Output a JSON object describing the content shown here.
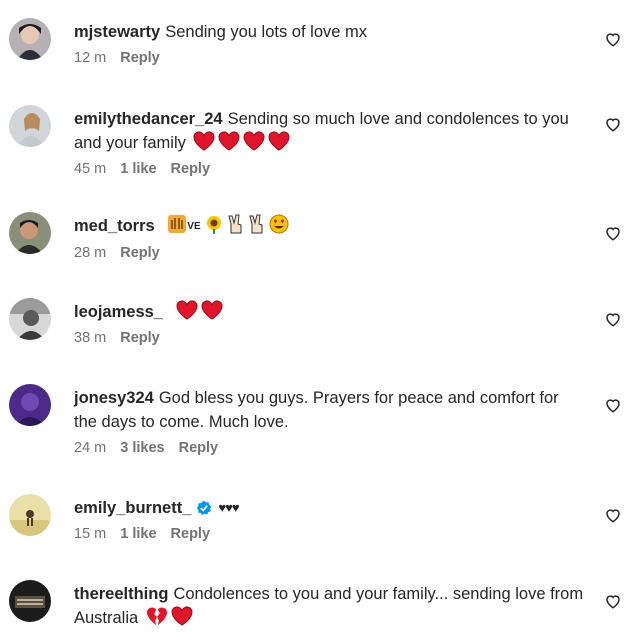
{
  "comments": [
    {
      "username": "mjstewarty",
      "text": "Sending you lots of love mx",
      "time": "12 m",
      "likes": "",
      "reply": "Reply"
    },
    {
      "username": "emilythedancer_24",
      "text": "Sending so much love and condolences to you and your family",
      "time": "45 m",
      "likes": "1 like",
      "reply": "Reply"
    },
    {
      "username": "med_torrs",
      "text": "",
      "time": "28 m",
      "likes": "",
      "reply": "Reply",
      "emoji_text": "VE"
    },
    {
      "username": "leojamess_",
      "text": "",
      "time": "38 m",
      "likes": "",
      "reply": "Reply"
    },
    {
      "username": "jonesy324",
      "text": "God bless you guys. Prayers for peace and comfort for the days to come. Much love.",
      "time": "24 m",
      "likes": "3 likes",
      "reply": "Reply"
    },
    {
      "username": "emily_burnett_",
      "text": "",
      "time": "15 m",
      "likes": "1 like",
      "reply": "Reply",
      "hearts": "♥♥♥"
    },
    {
      "username": "thereelthing",
      "text": "Condolences to you and your family... sending love from Australia",
      "time": "",
      "likes": "",
      "reply": ""
    }
  ],
  "colors": {
    "heart_red": "#e0152b",
    "verified_blue": "#0095f6",
    "meta_gray": "#737373"
  }
}
